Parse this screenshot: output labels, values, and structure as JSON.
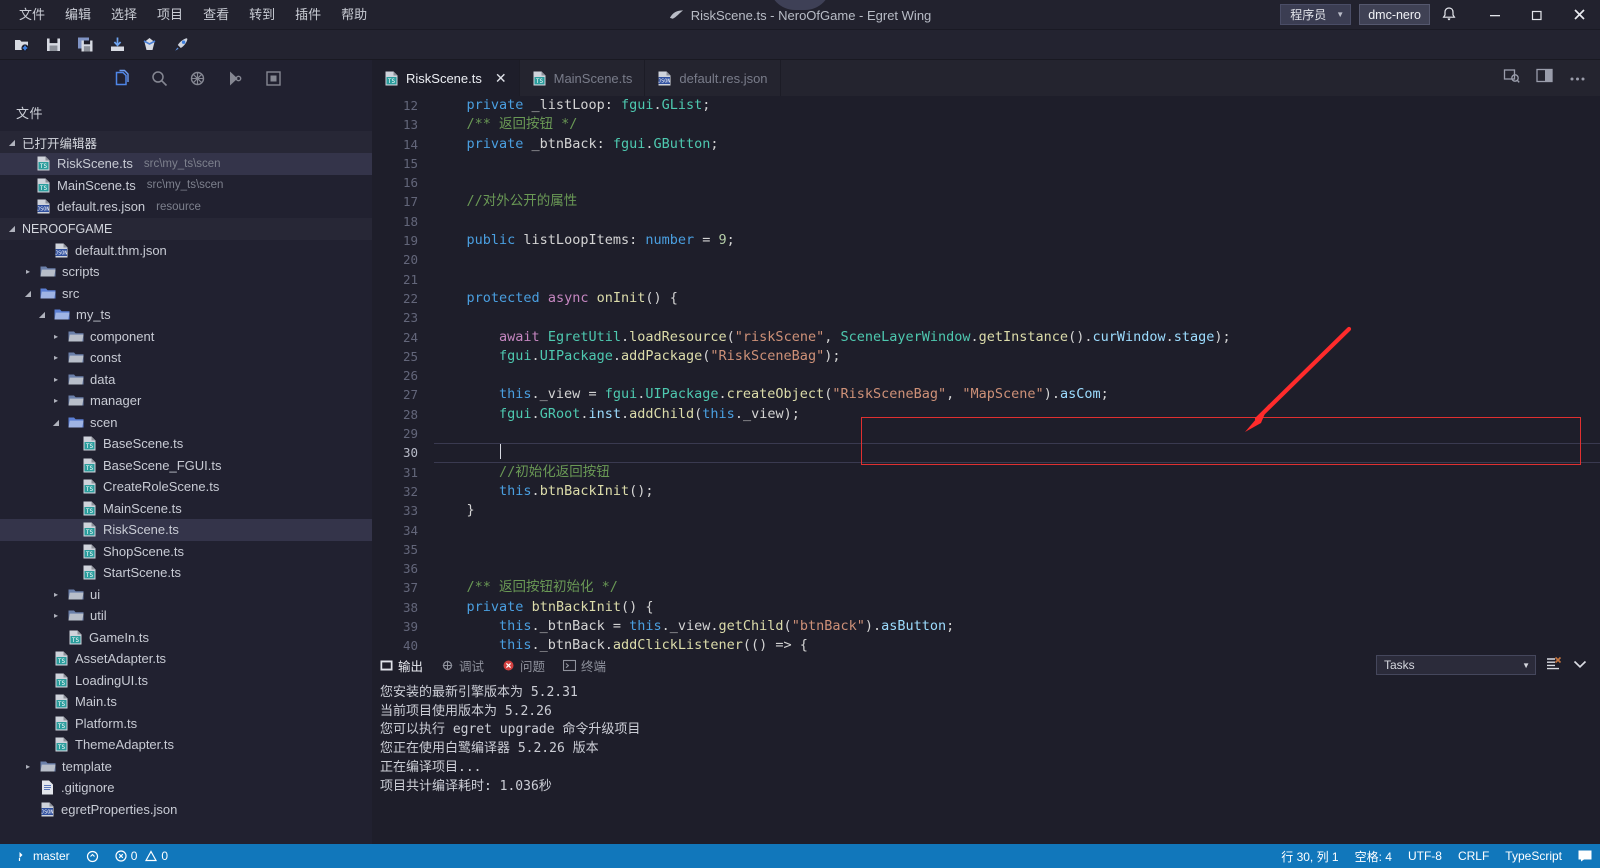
{
  "titlebar": {
    "menus": [
      "文件",
      "编辑",
      "选择",
      "项目",
      "查看",
      "转到",
      "插件",
      "帮助"
    ],
    "title": "RiskScene.ts - NeroOfGame - Egret Wing",
    "role_label": "程序员",
    "user_label": "dmc-nero",
    "bell_icon": "bell-icon",
    "minimize_label": "—",
    "maximize_label": "❐",
    "close_label": "✕"
  },
  "toolbar": {
    "icons": [
      "new-file-icon",
      "save-icon",
      "save-all-icon",
      "import-icon",
      "publish-icon",
      "run-icon"
    ]
  },
  "activity": {
    "items": [
      "explorer-icon",
      "search-icon",
      "debug-icon",
      "source-control-icon",
      "extensions-icon"
    ]
  },
  "layout_toggles": [
    "toggle-sidebar-icon",
    "toggle-panel-icon",
    "toggle-right-panel-icon"
  ],
  "sidebar": {
    "title": "文件",
    "open_editors": {
      "label": "已打开编辑器",
      "items": [
        {
          "name": "RiskScene.ts",
          "path": "src\\my_ts\\scen",
          "icon": "ts-file-icon",
          "selected": true
        },
        {
          "name": "MainScene.ts",
          "path": "src\\my_ts\\scen",
          "icon": "ts-file-icon",
          "selected": false
        },
        {
          "name": "default.res.json",
          "path": "resource",
          "icon": "json-file-icon",
          "selected": false
        }
      ]
    },
    "project": {
      "label": "NEROOFGAME",
      "items": [
        {
          "name": "default.thm.json",
          "type": "json",
          "indent": 2,
          "expanded": null
        },
        {
          "name": "scripts",
          "type": "folder",
          "indent": 1,
          "expanded": false
        },
        {
          "name": "src",
          "type": "folder",
          "indent": 1,
          "expanded": true
        },
        {
          "name": "my_ts",
          "type": "folder",
          "indent": 2,
          "expanded": true
        },
        {
          "name": "component",
          "type": "folder",
          "indent": 3,
          "expanded": false
        },
        {
          "name": "const",
          "type": "folder",
          "indent": 3,
          "expanded": false
        },
        {
          "name": "data",
          "type": "folder",
          "indent": 3,
          "expanded": false
        },
        {
          "name": "manager",
          "type": "folder",
          "indent": 3,
          "expanded": false
        },
        {
          "name": "scen",
          "type": "folder",
          "indent": 3,
          "expanded": true
        },
        {
          "name": "BaseScene.ts",
          "type": "ts",
          "indent": 4
        },
        {
          "name": "BaseScene_FGUI.ts",
          "type": "ts",
          "indent": 4
        },
        {
          "name": "CreateRoleScene.ts",
          "type": "ts",
          "indent": 4
        },
        {
          "name": "MainScene.ts",
          "type": "ts",
          "indent": 4
        },
        {
          "name": "RiskScene.ts",
          "type": "ts",
          "indent": 4,
          "selected": true
        },
        {
          "name": "ShopScene.ts",
          "type": "ts",
          "indent": 4
        },
        {
          "name": "StartScene.ts",
          "type": "ts",
          "indent": 4
        },
        {
          "name": "ui",
          "type": "folder",
          "indent": 3,
          "expanded": false
        },
        {
          "name": "util",
          "type": "folder",
          "indent": 3,
          "expanded": false
        },
        {
          "name": "GameIn.ts",
          "type": "ts",
          "indent": 3
        },
        {
          "name": "AssetAdapter.ts",
          "type": "ts",
          "indent": 2
        },
        {
          "name": "LoadingUI.ts",
          "type": "ts",
          "indent": 2
        },
        {
          "name": "Main.ts",
          "type": "ts",
          "indent": 2
        },
        {
          "name": "Platform.ts",
          "type": "ts",
          "indent": 2
        },
        {
          "name": "ThemeAdapter.ts",
          "type": "ts",
          "indent": 2
        },
        {
          "name": "template",
          "type": "folder",
          "indent": 1,
          "expanded": false
        },
        {
          "name": ".gitignore",
          "type": "file",
          "indent": 1
        },
        {
          "name": "egretProperties.json",
          "type": "json",
          "indent": 1
        }
      ]
    }
  },
  "editor": {
    "tabs": [
      {
        "label": "RiskScene.ts",
        "icon": "ts-file-icon",
        "active": true,
        "close_label": "✕"
      },
      {
        "label": "MainScene.ts",
        "icon": "ts-file-icon",
        "active": false
      },
      {
        "label": "default.res.json",
        "icon": "json-file-icon",
        "active": false
      }
    ],
    "actions": [
      "preview-icon",
      "split-editor-icon",
      "more-actions-icon"
    ],
    "first_line_number": 12,
    "current_line": 30,
    "lines": [
      {
        "n": 12,
        "tokens": [
          [
            "pl",
            "    "
          ],
          [
            "kw",
            "private"
          ],
          [
            "pl",
            " _listLoop: "
          ],
          [
            "ty",
            "fgui"
          ],
          [
            "pl",
            "."
          ],
          [
            "ty",
            "GList"
          ],
          [
            "pl",
            ";"
          ]
        ]
      },
      {
        "n": 13,
        "tokens": [
          [
            "pl",
            "    "
          ],
          [
            "cm",
            "/** 返回按钮 */"
          ]
        ]
      },
      {
        "n": 14,
        "tokens": [
          [
            "pl",
            "    "
          ],
          [
            "kw",
            "private"
          ],
          [
            "pl",
            " _btnBack: "
          ],
          [
            "ty",
            "fgui"
          ],
          [
            "pl",
            "."
          ],
          [
            "ty",
            "GButton"
          ],
          [
            "pl",
            ";"
          ]
        ]
      },
      {
        "n": 15,
        "tokens": []
      },
      {
        "n": 16,
        "tokens": []
      },
      {
        "n": 17,
        "tokens": [
          [
            "pl",
            "    "
          ],
          [
            "cm",
            "//对外公开的属性"
          ]
        ]
      },
      {
        "n": 18,
        "tokens": []
      },
      {
        "n": 19,
        "tokens": [
          [
            "pl",
            "    "
          ],
          [
            "kw",
            "public"
          ],
          [
            "pl",
            " listLoopItems: "
          ],
          [
            "kw",
            "number"
          ],
          [
            "pl",
            " = "
          ],
          [
            "num",
            "9"
          ],
          [
            "pl",
            ";"
          ]
        ]
      },
      {
        "n": 20,
        "tokens": []
      },
      {
        "n": 21,
        "tokens": []
      },
      {
        "n": 22,
        "tokens": [
          [
            "pl",
            "    "
          ],
          [
            "kw",
            "protected"
          ],
          [
            "pl",
            " "
          ],
          [
            "kw2",
            "async"
          ],
          [
            "pl",
            " "
          ],
          [
            "fn",
            "onInit"
          ],
          [
            "pl",
            "() {"
          ]
        ]
      },
      {
        "n": 23,
        "tokens": []
      },
      {
        "n": 24,
        "tokens": [
          [
            "pl",
            "        "
          ],
          [
            "kw2",
            "await"
          ],
          [
            "pl",
            " "
          ],
          [
            "ty",
            "EgretUtil"
          ],
          [
            "pl",
            "."
          ],
          [
            "fn",
            "loadResource"
          ],
          [
            "pl",
            "("
          ],
          [
            "str",
            "\"riskScene\""
          ],
          [
            "pl",
            ", "
          ],
          [
            "ty",
            "SceneLayerWindow"
          ],
          [
            "pl",
            "."
          ],
          [
            "fn",
            "getInstance"
          ],
          [
            "pl",
            "()."
          ],
          [
            "var",
            "curWindow"
          ],
          [
            "pl",
            "."
          ],
          [
            "var",
            "stage"
          ],
          [
            "pl",
            ");"
          ]
        ]
      },
      {
        "n": 25,
        "tokens": [
          [
            "pl",
            "        "
          ],
          [
            "ty",
            "fgui"
          ],
          [
            "pl",
            "."
          ],
          [
            "ty",
            "UIPackage"
          ],
          [
            "pl",
            "."
          ],
          [
            "fn",
            "addPackage"
          ],
          [
            "pl",
            "("
          ],
          [
            "str",
            "\"RiskSceneBag\""
          ],
          [
            "pl",
            ");"
          ]
        ]
      },
      {
        "n": 26,
        "tokens": []
      },
      {
        "n": 27,
        "tokens": [
          [
            "pl",
            "        "
          ],
          [
            "kw",
            "this"
          ],
          [
            "pl",
            "._view = "
          ],
          [
            "ty",
            "fgui"
          ],
          [
            "pl",
            "."
          ],
          [
            "ty",
            "UIPackage"
          ],
          [
            "pl",
            "."
          ],
          [
            "fn",
            "createObject"
          ],
          [
            "pl",
            "("
          ],
          [
            "str",
            "\"RiskSceneBag\""
          ],
          [
            "pl",
            ", "
          ],
          [
            "str",
            "\"MapScene\""
          ],
          [
            "pl",
            ")."
          ],
          [
            "var",
            "asCom"
          ],
          [
            "pl",
            ";"
          ]
        ]
      },
      {
        "n": 28,
        "tokens": [
          [
            "pl",
            "        "
          ],
          [
            "ty",
            "fgui"
          ],
          [
            "pl",
            "."
          ],
          [
            "ty",
            "GRoot"
          ],
          [
            "pl",
            "."
          ],
          [
            "var",
            "inst"
          ],
          [
            "pl",
            "."
          ],
          [
            "fn",
            "addChild"
          ],
          [
            "pl",
            "("
          ],
          [
            "kw",
            "this"
          ],
          [
            "pl",
            "._view);"
          ]
        ]
      },
      {
        "n": 29,
        "tokens": []
      },
      {
        "n": 30,
        "tokens": [],
        "current": true
      },
      {
        "n": 31,
        "tokens": [
          [
            "pl",
            "        "
          ],
          [
            "cm",
            "//初始化返回按钮"
          ]
        ]
      },
      {
        "n": 32,
        "tokens": [
          [
            "pl",
            "        "
          ],
          [
            "kw",
            "this"
          ],
          [
            "pl",
            "."
          ],
          [
            "fn",
            "btnBackInit"
          ],
          [
            "pl",
            "();"
          ]
        ]
      },
      {
        "n": 33,
        "tokens": [
          [
            "pl",
            "    }"
          ]
        ]
      },
      {
        "n": 34,
        "tokens": []
      },
      {
        "n": 35,
        "tokens": []
      },
      {
        "n": 36,
        "tokens": []
      },
      {
        "n": 37,
        "tokens": [
          [
            "pl",
            "    "
          ],
          [
            "cm",
            "/** 返回按钮初始化 */"
          ]
        ]
      },
      {
        "n": 38,
        "tokens": [
          [
            "pl",
            "    "
          ],
          [
            "kw",
            "private"
          ],
          [
            "pl",
            " "
          ],
          [
            "fn",
            "btnBackInit"
          ],
          [
            "pl",
            "() {"
          ]
        ]
      },
      {
        "n": 39,
        "tokens": [
          [
            "pl",
            "        "
          ],
          [
            "kw",
            "this"
          ],
          [
            "pl",
            "._btnBack = "
          ],
          [
            "kw",
            "this"
          ],
          [
            "pl",
            "._view."
          ],
          [
            "fn",
            "getChild"
          ],
          [
            "pl",
            "("
          ],
          [
            "str",
            "\"btnBack\""
          ],
          [
            "pl",
            ")."
          ],
          [
            "var",
            "asButton"
          ],
          [
            "pl",
            ";"
          ]
        ]
      },
      {
        "n": 40,
        "tokens": [
          [
            "pl",
            "        "
          ],
          [
            "kw",
            "this"
          ],
          [
            "pl",
            "._btnBack."
          ],
          [
            "fn",
            "addClickListener"
          ],
          [
            "pl",
            "(() => {"
          ]
        ]
      }
    ],
    "annotation": {
      "highlight_box_color": "#e03030",
      "arrow_color": "#ff2b2b"
    }
  },
  "panel": {
    "tabs": [
      {
        "label": "输出",
        "icon": "output-icon",
        "active": true
      },
      {
        "label": "调试",
        "icon": "debug-console-icon",
        "active": false
      },
      {
        "label": "问题",
        "icon": "problems-icon",
        "active": false
      },
      {
        "label": "终端",
        "icon": "terminal-icon",
        "active": false
      }
    ],
    "task_select": {
      "value": "Tasks",
      "caret": "▼"
    },
    "right_icons": [
      "clear-output-icon",
      "close-panel-icon"
    ],
    "output_lines": [
      "您安装的最新引擎版本为 5.2.31",
      "当前项目使用版本为 5.2.26",
      "您可以执行 egret upgrade 命令升级项目",
      "您正在使用白鹭编译器 5.2.26 版本",
      "正在编译项目...",
      "项目共计编译耗时: 1.036秒"
    ]
  },
  "statusbar": {
    "branch": "master",
    "sync_icon": "sync-icon",
    "errors": "0",
    "warnings": "0",
    "cursor": "行 30, 列 1",
    "spaces": "空格: 4",
    "encoding": "UTF-8",
    "eol": "CRLF",
    "language": "TypeScript",
    "feedback_icon": "feedback-icon",
    "accent": "#1177bb"
  }
}
